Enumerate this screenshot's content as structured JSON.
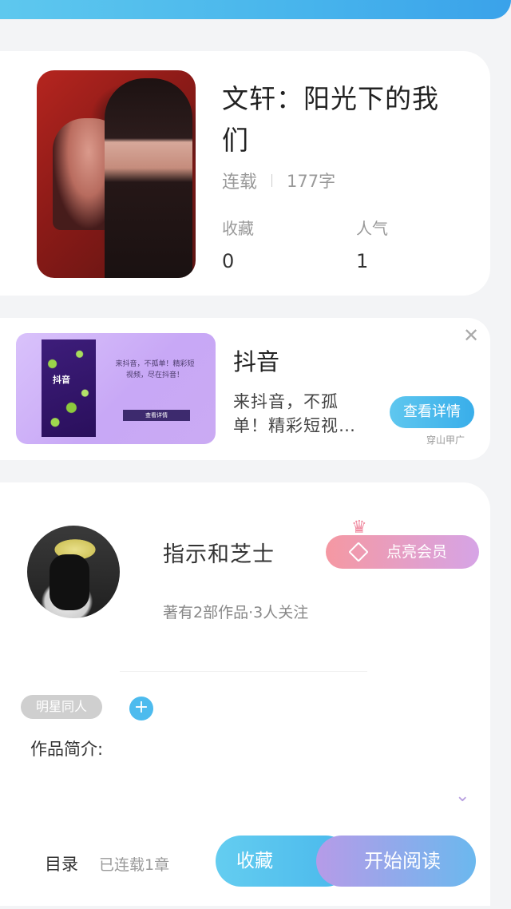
{
  "book": {
    "title": "文轩：阳光下的我们",
    "status": "连载",
    "word_count": "177字",
    "favorites_label": "收藏",
    "favorites_value": "0",
    "popularity_label": "人气",
    "popularity_value": "1"
  },
  "ad": {
    "image_text": "来抖音，不孤单！精彩短视频，尽在抖音！",
    "image_logo": "抖音",
    "image_button": "查看详情",
    "title": "抖音",
    "description": "来抖音，不孤单！精彩短视…",
    "detail_button": "查看详情",
    "source": "穿山甲广",
    "close_symbol": "✕"
  },
  "author": {
    "name": "指示和芝士",
    "meta": "著有2部作品·3人关注",
    "vip_button": "点亮会员"
  },
  "tags": {
    "items": [
      "明星同人"
    ],
    "add_symbol": "+"
  },
  "intro": {
    "label": "作品简介:"
  },
  "bottom_bar": {
    "toc_label": "目录",
    "toc_status": "已连载1章",
    "favorite_button": "收藏",
    "read_button": "开始阅读"
  },
  "icons": {
    "close": "close-icon",
    "crown": "crown-icon",
    "diamond": "diamond-icon",
    "add": "plus-icon",
    "expand": "chevron-down-icon"
  },
  "colors": {
    "accent_blue": "#49b8ec",
    "vip_pink": "#f598a2",
    "vip_purple": "#d6a4e6"
  }
}
